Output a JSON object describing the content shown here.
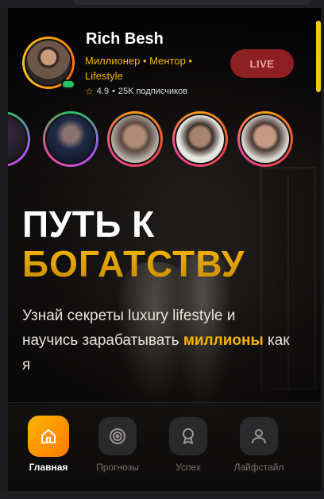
{
  "profile": {
    "name": "Rich Besh",
    "tagline": "Миллионер • Ментор • Lifestyle",
    "rating": "4.9",
    "subscribers": "25K подписчиков",
    "online": true
  },
  "live_label": "LIVE",
  "headline": {
    "line1": "ПУТЬ К",
    "line2": "БОГАТСТВУ"
  },
  "subtitle": {
    "part1": "Узнай секреты luxury lifestyle и научись зарабатывать ",
    "highlight": "миллионы",
    "part2": " как я"
  },
  "nav": [
    {
      "label": "Главная",
      "icon": "home-icon",
      "active": true
    },
    {
      "label": "Прогнозы",
      "icon": "target-icon",
      "active": false
    },
    {
      "label": "Успех",
      "icon": "award-icon",
      "active": false
    },
    {
      "label": "Лайфстайл",
      "icon": "user-icon",
      "active": false
    }
  ],
  "colors": {
    "accent": "#f5b400",
    "live": "#8e1f22",
    "online": "#22c55e"
  }
}
